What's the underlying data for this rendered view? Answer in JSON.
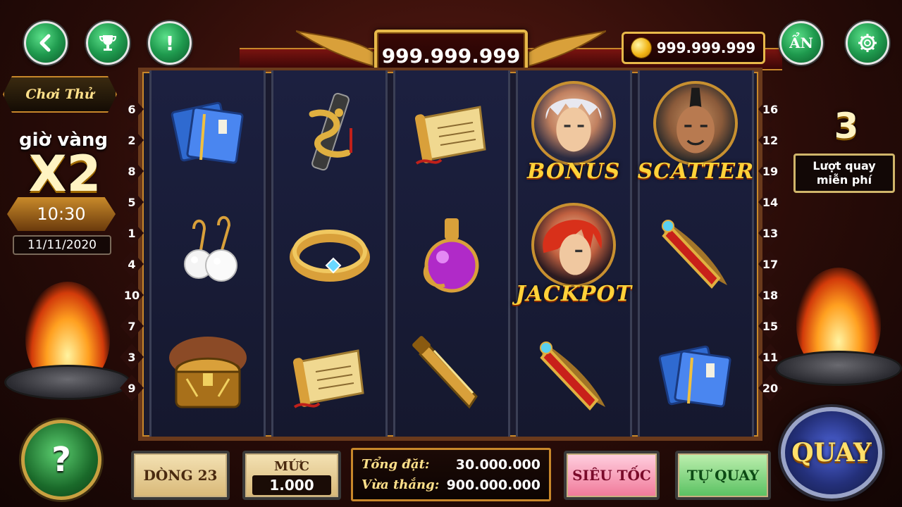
{
  "header": {
    "jackpot_value": "999.999.999",
    "coin_balance": "999.999.999",
    "hide_label": "ẨN"
  },
  "left_panel": {
    "try_label": "Chơi Thử",
    "gold_hour_label": "giờ vàng",
    "multiplier": "X2",
    "time": "10:30",
    "date": "11/11/2020"
  },
  "lines_left": [
    "6",
    "2",
    "8",
    "5",
    "1",
    "4",
    "10",
    "7",
    "3",
    "9"
  ],
  "lines_right": [
    "16",
    "12",
    "19",
    "14",
    "13",
    "17",
    "18",
    "15",
    "11",
    "20"
  ],
  "reels": [
    [
      "book-icon",
      "earrings-icon",
      "treasure-chest-icon"
    ],
    [
      "dragon-scroll-icon",
      "ring-icon",
      "scroll-icon"
    ],
    [
      "scroll-icon",
      "potion-icon",
      "sword-icon"
    ],
    [
      "bonus",
      "jackpot",
      "flame-sword-icon"
    ],
    [
      "scatter",
      "flame-sword-icon",
      "book-icon"
    ]
  ],
  "symbol_labels": {
    "bonus": "BONUS",
    "jackpot": "JACKPOT",
    "scatter": "SCATTER"
  },
  "free_spins": {
    "count": "3",
    "label_line1": "Lượt quay",
    "label_line2": "miễn phí"
  },
  "controls": {
    "line_label": "DÒNG 23",
    "level_label": "MỨC",
    "level_value": "1.000",
    "total_bet_label": "Tổng đặt:",
    "total_bet_value": "30.000.000",
    "last_win_label": "Vừa thắng:",
    "last_win_value": "900.000.000",
    "turbo_label": "SIÊU TỐC",
    "auto_label": "TỰ QUAY",
    "spin_label": "QUAY",
    "help_label": "?"
  },
  "colors": {
    "accent_gold": "#e8b94a",
    "button_green": "#1f9a4e",
    "reel_bg": "#1c2040"
  }
}
